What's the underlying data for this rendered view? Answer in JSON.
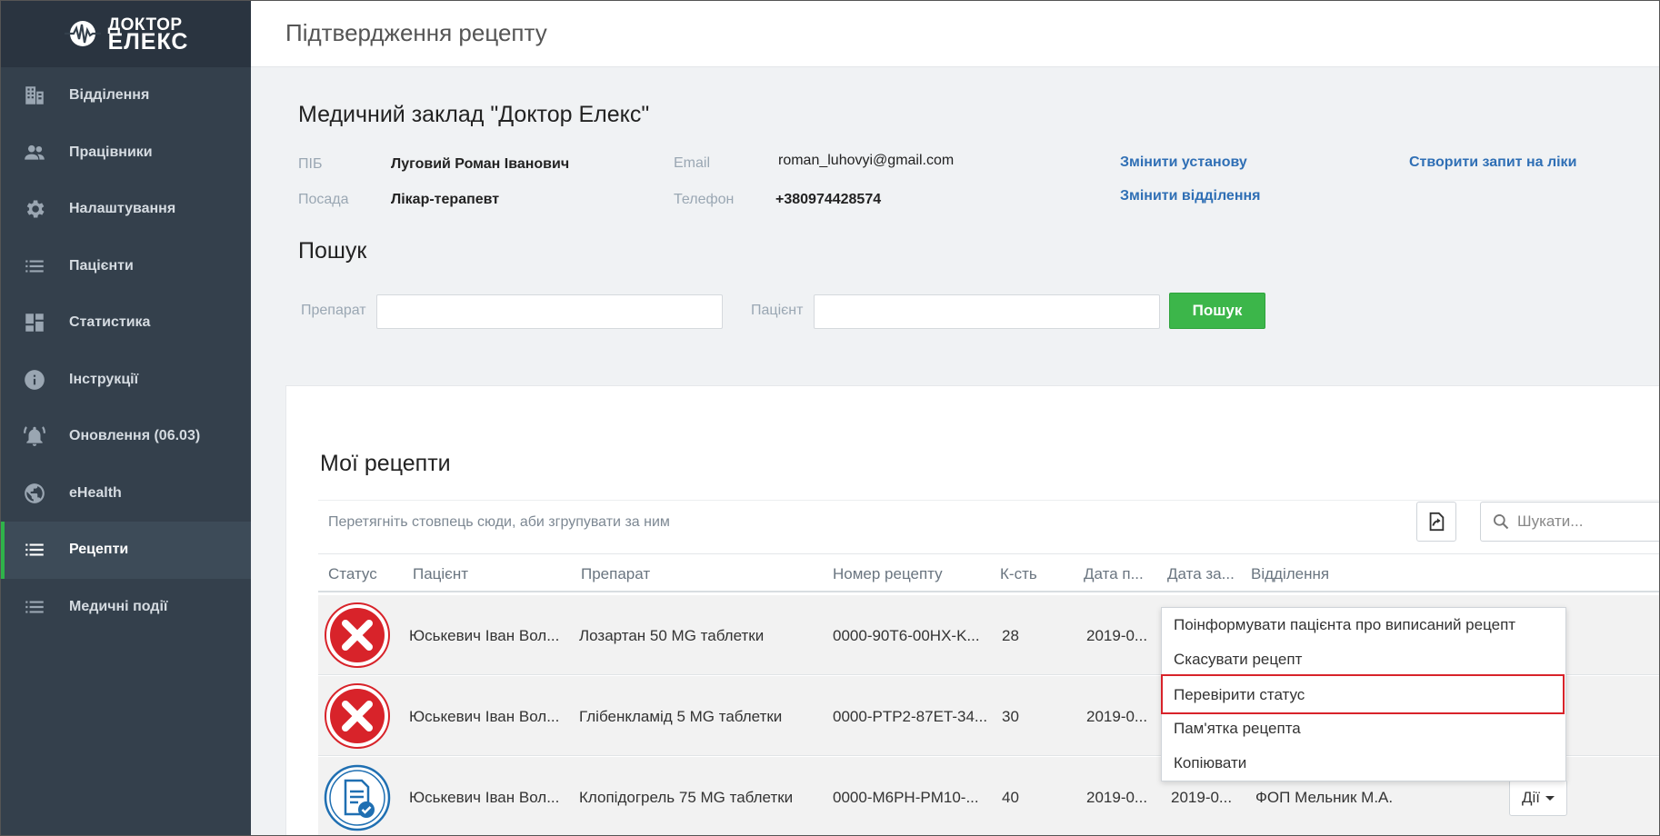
{
  "brand": {
    "line1": "ДОКТОР",
    "line2": "ЕЛЕКС"
  },
  "sidebar": {
    "items": [
      {
        "label": "Відділення",
        "icon": "building-icon"
      },
      {
        "label": "Працівники",
        "icon": "people-icon"
      },
      {
        "label": "Налаштування",
        "icon": "gear-icon"
      },
      {
        "label": "Пацієнти",
        "icon": "list-icon"
      },
      {
        "label": "Статистика",
        "icon": "dashboard-icon"
      },
      {
        "label": "Інструкції",
        "icon": "info-icon"
      },
      {
        "label": "Оновлення (06.03)",
        "icon": "bell-icon"
      },
      {
        "label": "eHealth",
        "icon": "globe-icon"
      },
      {
        "label": "Рецепти",
        "icon": "list-icon",
        "active": true
      },
      {
        "label": "Медичні події",
        "icon": "list-icon"
      }
    ]
  },
  "header": {
    "title": "Підтвердження рецепту"
  },
  "info": {
    "org_title": "Медичний заклад \"Доктор Елекс\"",
    "name_label": "ПІБ",
    "name_value": "Луговий Роман Іванович",
    "position_label": "Посада",
    "position_value": "Лікар-терапевт",
    "email_label": "Email",
    "email_value": "roman_luhovyi@gmail.com",
    "phone_label": "Телефон",
    "phone_value": "+380974428574",
    "change_institution": "Змінити установу",
    "change_department": "Змінити відділення",
    "create_request": "Створити запит на ліки"
  },
  "search": {
    "title": "Пошук",
    "drug_label": "Препарат",
    "drug_value": "",
    "patient_label": "Пацієнт",
    "patient_value": "",
    "button": "Пошук"
  },
  "prescriptions": {
    "title": "Мої рецепти",
    "group_hint": "Перетягніть стовпець сюди, аби згрупувати за ним",
    "search_placeholder": "Шукати...",
    "columns": [
      "Статус",
      "Пацієнт",
      "Препарат",
      "Номер рецепту",
      "К-сть",
      "Дата п...",
      "Дата за...",
      "Відділення"
    ],
    "rows": [
      {
        "status": "cancelled",
        "patient": "Юськевич Іван Вол...",
        "drug": "Лозартан 50 MG таблетки",
        "number": "0000-90T6-00HX-K...",
        "qty": "28",
        "date1": "2019-0...",
        "date2": "",
        "department": ""
      },
      {
        "status": "cancelled",
        "patient": "Юськевич Іван Вол...",
        "drug": "Глібенкламід 5 MG таблетки",
        "number": "0000-PTP2-87ET-34...",
        "qty": "30",
        "date1": "2019-0...",
        "date2": "",
        "department": ""
      },
      {
        "status": "issued",
        "patient": "Юськевич Іван Вол...",
        "drug": "Клопідогрель 75 MG таблетки",
        "number": "0000-M6PH-PM10-...",
        "qty": "40",
        "date1": "2019-0...",
        "date2": "2019-0...",
        "department": "ФОП Мельник М.А."
      }
    ],
    "actions_label": "Дії"
  },
  "menu": {
    "items": [
      "Поінформувати пацієнта про виписаний рецепт",
      "Скасувати рецепт",
      "Перевірити статус",
      "Пам'ятка рецепта",
      "Копіювати"
    ],
    "highlighted_index": 2
  },
  "colors": {
    "sidebar": "#34404c",
    "accent_green": "#3cb64a",
    "link": "#2f6fb5",
    "status_red": "#d8232a",
    "status_blue": "#1f6fb2"
  }
}
